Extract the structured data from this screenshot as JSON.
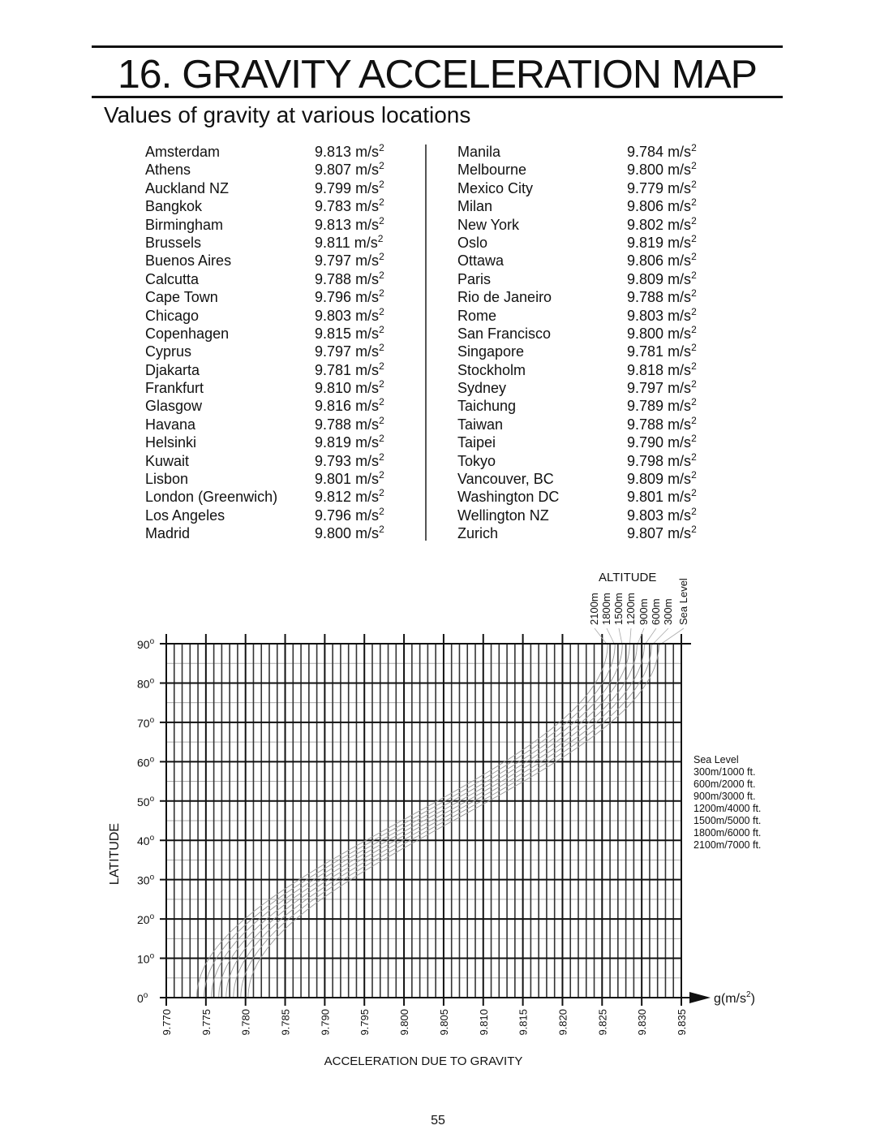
{
  "page": {
    "title": "16. GRAVITY ACCELERATION MAP",
    "subtitle": "Values of gravity at various locations",
    "page_number": "55"
  },
  "unit": "m/s",
  "unit_exponent": "2",
  "locations_left": [
    {
      "city": "Amsterdam",
      "value": "9.813"
    },
    {
      "city": "Athens",
      "value": "9.807"
    },
    {
      "city": "Auckland NZ",
      "value": "9.799"
    },
    {
      "city": "Bangkok",
      "value": "9.783"
    },
    {
      "city": "Birmingham",
      "value": "9.813"
    },
    {
      "city": "Brussels",
      "value": "9.811"
    },
    {
      "city": "Buenos Aires",
      "value": "9.797"
    },
    {
      "city": "Calcutta",
      "value": "9.788"
    },
    {
      "city": "Cape Town",
      "value": "9.796"
    },
    {
      "city": "Chicago",
      "value": "9.803"
    },
    {
      "city": "Copenhagen",
      "value": "9.815"
    },
    {
      "city": "Cyprus",
      "value": "9.797"
    },
    {
      "city": "Djakarta",
      "value": "9.781"
    },
    {
      "city": "Frankfurt",
      "value": "9.810"
    },
    {
      "city": "Glasgow",
      "value": "9.816"
    },
    {
      "city": "Havana",
      "value": "9.788"
    },
    {
      "city": "Helsinki",
      "value": "9.819"
    },
    {
      "city": "Kuwait",
      "value": "9.793"
    },
    {
      "city": "Lisbon",
      "value": "9.801"
    },
    {
      "city": "London (Greenwich)",
      "value": "9.812"
    },
    {
      "city": "Los Angeles",
      "value": "9.796"
    },
    {
      "city": "Madrid",
      "value": "9.800"
    }
  ],
  "locations_right": [
    {
      "city": "Manila",
      "value": "9.784"
    },
    {
      "city": "Melbourne",
      "value": "9.800"
    },
    {
      "city": "Mexico City",
      "value": "9.779"
    },
    {
      "city": "Milan",
      "value": "9.806"
    },
    {
      "city": "New York",
      "value": "9.802"
    },
    {
      "city": "Oslo",
      "value": "9.819"
    },
    {
      "city": "Ottawa",
      "value": "9.806"
    },
    {
      "city": "Paris",
      "value": "9.809"
    },
    {
      "city": "Rio de Janeiro",
      "value": "9.788"
    },
    {
      "city": "Rome",
      "value": "9.803"
    },
    {
      "city": "San Francisco",
      "value": "9.800"
    },
    {
      "city": "Singapore",
      "value": "9.781"
    },
    {
      "city": "Stockholm",
      "value": "9.818"
    },
    {
      "city": "Sydney",
      "value": "9.797"
    },
    {
      "city": "Taichung",
      "value": "9.789"
    },
    {
      "city": "Taiwan",
      "value": "9.788"
    },
    {
      "city": "Taipei",
      "value": "9.790"
    },
    {
      "city": "Tokyo",
      "value": "9.798"
    },
    {
      "city": "Vancouver, BC",
      "value": "9.809"
    },
    {
      "city": "Washington DC",
      "value": "9.801"
    },
    {
      "city": "Wellington NZ",
      "value": "9.803"
    },
    {
      "city": "Zurich",
      "value": "9.807"
    }
  ],
  "chart_data": {
    "type": "line",
    "title": "",
    "xlabel": "ACCELERATION DUE TO GRAVITY",
    "ylabel": "LATITUDE",
    "x_unit_label": "g(m/s",
    "x_unit_exponent": "2",
    "x_unit_close": ")",
    "xlim": [
      9.77,
      9.835
    ],
    "ylim": [
      0,
      90
    ],
    "x_ticks": [
      "9.770",
      "9.775",
      "9.780",
      "9.785",
      "9.790",
      "9.795",
      "9.800",
      "9.805",
      "9.810",
      "9.815",
      "9.820",
      "9.825",
      "9.830",
      "9.835"
    ],
    "x_minor_step": 0.001,
    "y_ticks": [
      "0",
      "10",
      "20",
      "30",
      "40",
      "50",
      "60",
      "70",
      "80",
      "90"
    ],
    "y_tick_suffix": "o",
    "y_minor_step": 5,
    "grid": true,
    "altitude_header": "ALTITUDE",
    "altitude_labels": [
      "2100m",
      "1800m",
      "1500m",
      "1200m",
      "900m",
      "600m",
      "300m",
      "Sea Level"
    ],
    "legend_title": "Sea Level",
    "legend_entries": [
      "300m/1000 ft.",
      "600m/2000 ft.",
      "900m/3000 ft.",
      "1200m/4000 ft.",
      "1500m/5000 ft.",
      "1800m/6000 ft.",
      "2100m/7000 ft."
    ],
    "legend_placement": "right",
    "series": [
      {
        "name": "Sea Level",
        "altitude_m": 0,
        "g_at_0deg": 9.78,
        "g_at_45deg": 9.806,
        "g_at_90deg": 9.832
      },
      {
        "name": "300m",
        "altitude_m": 300,
        "g_at_0deg": 9.779,
        "g_at_45deg": 9.805,
        "g_at_90deg": 9.831
      },
      {
        "name": "600m",
        "altitude_m": 600,
        "g_at_0deg": 9.778,
        "g_at_45deg": 9.804,
        "g_at_90deg": 9.83
      },
      {
        "name": "900m",
        "altitude_m": 900,
        "g_at_0deg": 9.777,
        "g_at_45deg": 9.803,
        "g_at_90deg": 9.829
      },
      {
        "name": "1200m",
        "altitude_m": 1200,
        "g_at_0deg": 9.777,
        "g_at_45deg": 9.803,
        "g_at_90deg": 9.829
      },
      {
        "name": "1500m",
        "altitude_m": 1500,
        "g_at_0deg": 9.776,
        "g_at_45deg": 9.802,
        "g_at_90deg": 9.828
      },
      {
        "name": "1800m",
        "altitude_m": 1800,
        "g_at_0deg": 9.775,
        "g_at_45deg": 9.801,
        "g_at_90deg": 9.827
      },
      {
        "name": "2100m",
        "altitude_m": 2100,
        "g_at_0deg": 9.774,
        "g_at_45deg": 9.8,
        "g_at_90deg": 9.826
      }
    ]
  }
}
